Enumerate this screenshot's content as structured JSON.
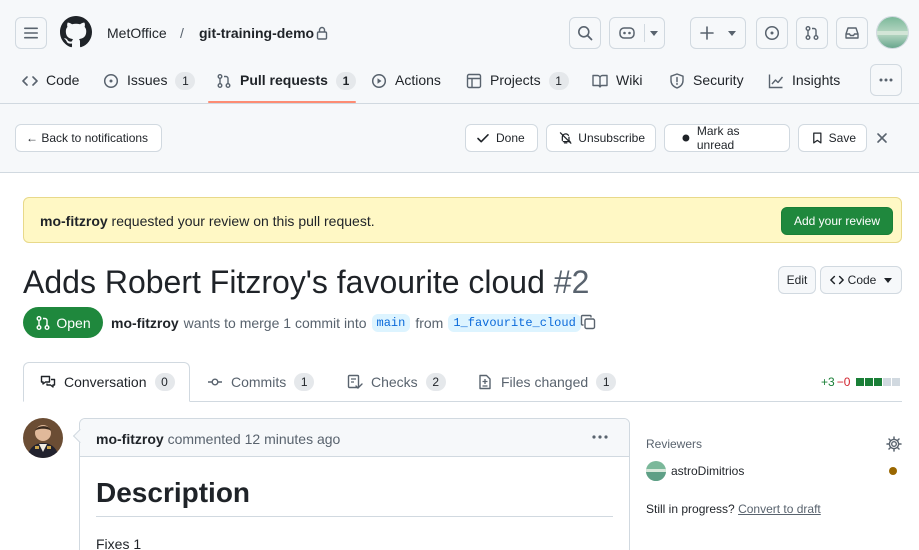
{
  "header": {
    "owner": "MetOffice",
    "separator": "/",
    "repo": "git-training-demo",
    "nav": [
      {
        "label": "Code",
        "count": null
      },
      {
        "label": "Issues",
        "count": "1"
      },
      {
        "label": "Pull requests",
        "count": "1"
      },
      {
        "label": "Actions",
        "count": null
      },
      {
        "label": "Projects",
        "count": "1"
      },
      {
        "label": "Wiki",
        "count": null
      },
      {
        "label": "Security",
        "count": null
      },
      {
        "label": "Insights",
        "count": null
      }
    ]
  },
  "notification_bar": {
    "back": "← Back to notifications",
    "done": "Done",
    "unsubscribe": "Unsubscribe",
    "mark_unread": "Mark as unread",
    "save": "Save"
  },
  "banner": {
    "user": "mo-fitzroy",
    "text": " requested your review on this pull request.",
    "button": "Add your review"
  },
  "pr": {
    "title": "Adds Robert Fitzroy's favourite cloud",
    "number": "#2",
    "edit": "Edit",
    "code": "Code",
    "state": "Open",
    "author": "mo-fitzroy",
    "merge_text": "wants to merge 1 commit into",
    "base": "main",
    "from": "from",
    "head": "1_favourite_cloud"
  },
  "tabs": [
    {
      "label": "Conversation",
      "count": "0"
    },
    {
      "label": "Commits",
      "count": "1"
    },
    {
      "label": "Checks",
      "count": "2"
    },
    {
      "label": "Files changed",
      "count": "1"
    }
  ],
  "diffstat": {
    "additions": "+3",
    "deletions": "−0",
    "colors": [
      "#1a7f37",
      "#1a7f37",
      "#1a7f37",
      "#d1d9e0",
      "#d1d9e0"
    ]
  },
  "comment": {
    "author": "mo-fitzroy",
    "action": "commented",
    "time": "12 minutes ago",
    "heading": "Description",
    "body": "Fixes 1"
  },
  "sidebar": {
    "reviewers_label": "Reviewers",
    "reviewer": "astroDimitrios",
    "draft_prefix": "Still in progress?",
    "draft_link": "Convert to draft"
  },
  "colors": {
    "accent_green": "#1f883d",
    "banner_bg": "#fff8c5",
    "nav_underline": "#fd8c73"
  }
}
